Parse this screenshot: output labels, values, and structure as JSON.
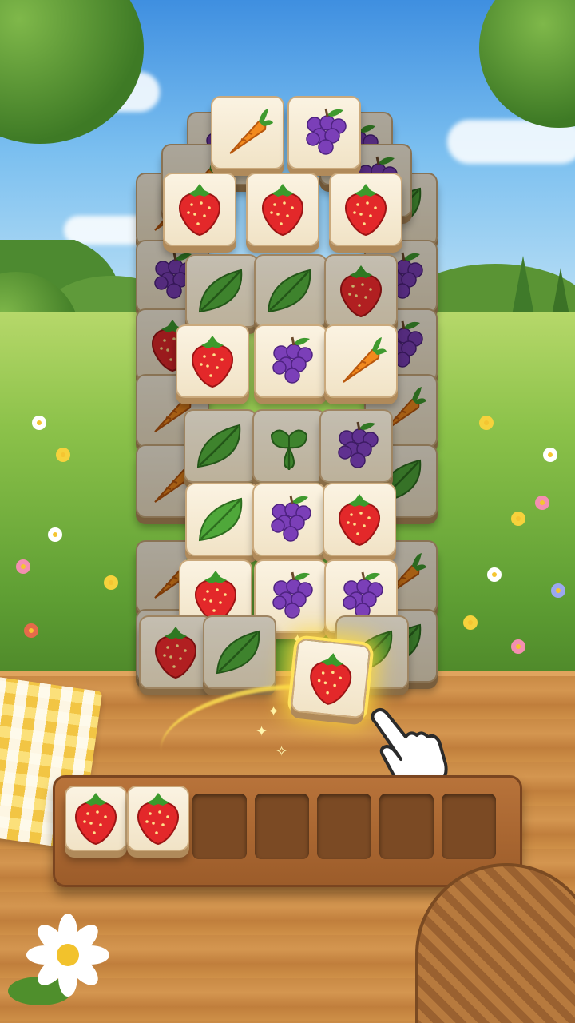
{
  "game": {
    "name": "",
    "tile_types": [
      "strawberry",
      "carrot",
      "grapes",
      "leaf",
      "clover"
    ]
  },
  "board": {
    "layers": [
      {
        "layer": "top",
        "tiles": [
          "carrot",
          "grapes"
        ]
      },
      {
        "layer": "row-2",
        "tiles": [
          "strawberry",
          "strawberry",
          "strawberry"
        ]
      },
      {
        "layer": "row-3",
        "tiles": [
          "leaf",
          "leaf",
          "strawberry"
        ]
      },
      {
        "layer": "row-4",
        "tiles": [
          "strawberry",
          "grapes",
          "carrot"
        ]
      },
      {
        "layer": "row-5",
        "tiles": [
          "leaf",
          "clover",
          "grapes"
        ]
      },
      {
        "layer": "row-6",
        "tiles": [
          "leaf",
          "grapes",
          "strawberry"
        ]
      },
      {
        "layer": "row-7",
        "tiles": [
          "strawberry",
          "grapes",
          "grapes"
        ]
      },
      {
        "layer": "row-8",
        "tiles": [
          "strawberry",
          "leaf",
          "leaf"
        ]
      }
    ]
  },
  "selected_tile": "strawberry",
  "tray": {
    "capacity": 7,
    "filled": [
      "strawberry",
      "strawberry"
    ]
  },
  "colors": {
    "tile_face": "#f8eedb",
    "tile_edge": "#b08a5a",
    "tray_wood": "#a8652f",
    "glow": "#ffe25c"
  },
  "icons": [
    "strawberry-icon",
    "carrot-icon",
    "grapes-icon",
    "leaf-icon",
    "clover-icon",
    "pointer-hand-icon"
  ]
}
